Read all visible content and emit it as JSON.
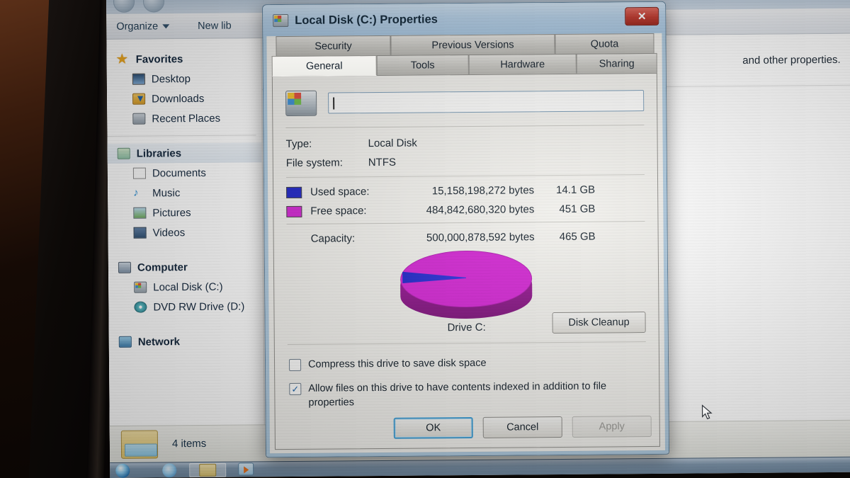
{
  "explorer": {
    "toolbar": [
      {
        "label": "Organize",
        "icon": "chevron-down-icon",
        "has_caret": true
      },
      {
        "label": "New lib",
        "icon": "none",
        "has_caret": false
      }
    ],
    "sidebar": {
      "sections": [
        {
          "head": {
            "label": "Favorites",
            "icon": "star-icon"
          },
          "items": [
            {
              "label": "Desktop",
              "icon": "desktop-icon"
            },
            {
              "label": "Downloads",
              "icon": "downloads-icon"
            },
            {
              "label": "Recent Places",
              "icon": "recent-places-icon"
            }
          ]
        },
        {
          "head": {
            "label": "Libraries",
            "icon": "libraries-icon"
          },
          "items": [
            {
              "label": "Documents",
              "icon": "document-icon"
            },
            {
              "label": "Music",
              "icon": "music-note-icon"
            },
            {
              "label": "Pictures",
              "icon": "picture-icon"
            },
            {
              "label": "Videos",
              "icon": "video-icon"
            }
          ]
        },
        {
          "head": {
            "label": "Computer",
            "icon": "computer-icon"
          },
          "items": [
            {
              "label": "Local Disk (C:)",
              "icon": "hard-disk-icon"
            },
            {
              "label": "DVD RW Drive (D:)",
              "icon": "dvd-drive-icon"
            }
          ]
        },
        {
          "head": {
            "label": "Network",
            "icon": "network-icon"
          },
          "items": []
        }
      ]
    },
    "content": {
      "blurb": "and other properties."
    },
    "status": {
      "item_count": "4 items",
      "icon": "folder-icon"
    },
    "taskbar": {
      "items": [
        {
          "name": "start-orb",
          "icon": "windows-orb-icon"
        },
        {
          "name": "internet-explorer",
          "icon": "internet-explorer-icon"
        },
        {
          "name": "windows-explorer",
          "icon": "folder-icon"
        },
        {
          "name": "windows-media-player",
          "icon": "media-player-icon"
        }
      ]
    }
  },
  "dialog": {
    "title": "Local Disk (C:) Properties",
    "title_icon": "hard-disk-icon",
    "close_label": "✕",
    "tabs_row1": [
      "Security",
      "Previous Versions",
      "Quota"
    ],
    "tabs_row2": [
      "General",
      "Tools",
      "Hardware",
      "Sharing"
    ],
    "active_tab": "General",
    "volume_label_value": "",
    "volume_label_placeholder": "",
    "info": {
      "type_label": "Type:",
      "type_value": "Local Disk",
      "fs_label": "File system:",
      "fs_value": "NTFS",
      "used_label": "Used space:",
      "used_bytes": "15,158,198,272 bytes",
      "used_gb": "14.1 GB",
      "used_color": "#1d24c8",
      "free_label": "Free space:",
      "free_bytes": "484,842,680,320 bytes",
      "free_gb": "451 GB",
      "free_color": "#d324d3",
      "capacity_label": "Capacity:",
      "capacity_bytes": "500,000,878,592 bytes",
      "capacity_gb": "465 GB"
    },
    "pie_caption": "Drive C:",
    "disk_cleanup_label": "Disk Cleanup",
    "checkboxes": [
      {
        "label": "Compress this drive to save disk space",
        "checked": false,
        "mark": ""
      },
      {
        "label": "Allow files on this drive to have contents indexed in addition to file properties",
        "checked": true,
        "mark": "✓"
      }
    ],
    "buttons": {
      "ok": "OK",
      "cancel": "Cancel",
      "apply": "Apply",
      "apply_disabled": true
    }
  },
  "chart_data": {
    "type": "pie",
    "title": "Drive C:",
    "categories": [
      "Used space",
      "Free space"
    ],
    "values": [
      15158198272,
      484842680320
    ],
    "labels": [
      "14.1 GB",
      "451 GB"
    ],
    "colors": [
      "#1d24c8",
      "#d324d3"
    ],
    "percentages": [
      3.03,
      96.97
    ],
    "total": 500000878592,
    "total_label": "465 GB",
    "legend": "inline-swatches",
    "grid": false
  }
}
